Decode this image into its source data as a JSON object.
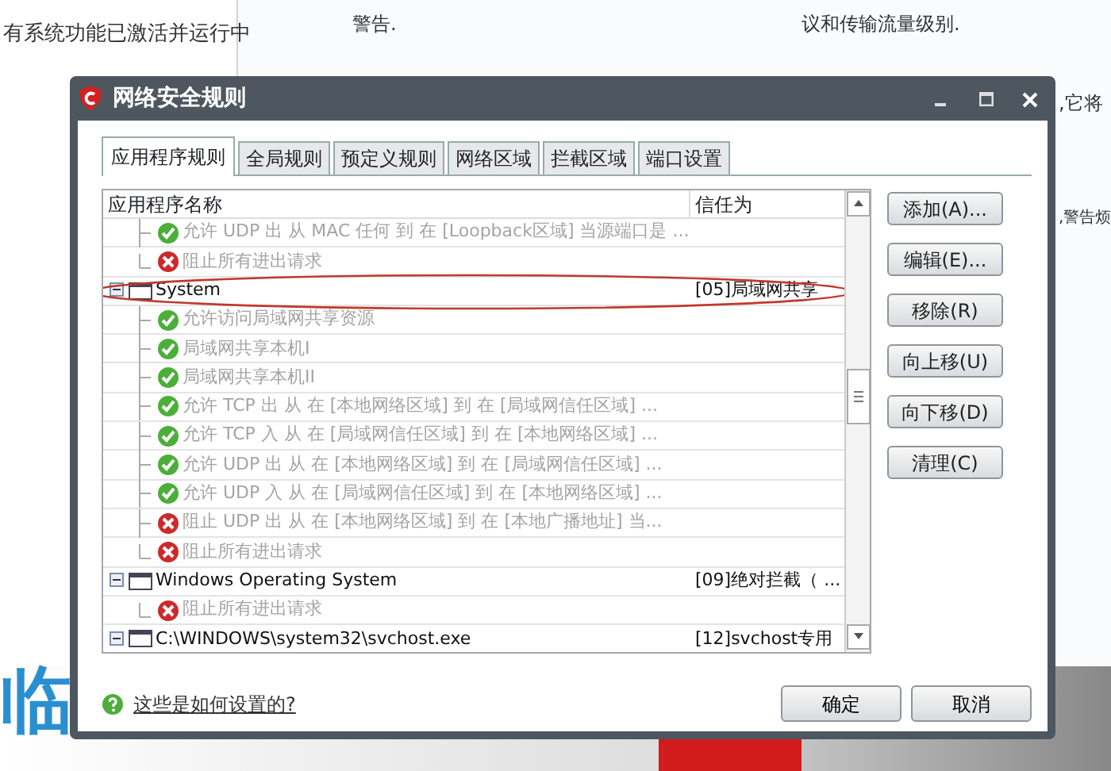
{
  "background": {
    "texts": [
      {
        "kind": "left",
        "text": "有系统功能已激活并运行中"
      },
      {
        "kind": "mid",
        "text": "警告."
      },
      {
        "kind": "right",
        "text": "议和传输流量级别."
      },
      {
        "kind": "edge1",
        "text": ",它将"
      },
      {
        "kind": "edge2",
        "text": ",警告烦"
      },
      {
        "kind": "big",
        "text": "临"
      }
    ]
  },
  "dialog": {
    "title": "网络安全规则",
    "tabs": [
      {
        "label": "应用程序规则",
        "selected": true
      },
      {
        "label": "全局规则",
        "selected": false
      },
      {
        "label": "预定义规则",
        "selected": false
      },
      {
        "label": "网络区域",
        "selected": false
      },
      {
        "label": "拦截区域",
        "selected": false
      },
      {
        "label": "端口设置",
        "selected": false
      }
    ],
    "table": {
      "columns": [
        "应用程序名称",
        "信任为"
      ],
      "rows": [
        {
          "kind": "rule",
          "blocked": false,
          "last": false,
          "name": "允许 UDP 出 从 MAC 任何 到 在 [Loopback区域] 当源端口是 ..."
        },
        {
          "kind": "rule",
          "blocked": true,
          "last": true,
          "name": "阻止所有进出请求"
        },
        {
          "kind": "group",
          "expanded": true,
          "highlighted": true,
          "name": "System",
          "trust": "[05]局域网共享"
        },
        {
          "kind": "rule",
          "blocked": false,
          "last": false,
          "name": "允许访问局域网共享资源"
        },
        {
          "kind": "rule",
          "blocked": false,
          "last": false,
          "name": "局域网共享本机I"
        },
        {
          "kind": "rule",
          "blocked": false,
          "last": false,
          "name": "局域网共享本机II"
        },
        {
          "kind": "rule",
          "blocked": false,
          "last": false,
          "name": "允许 TCP 出 从 在 [本地网络区域] 到 在 [局域网信任区域] ..."
        },
        {
          "kind": "rule",
          "blocked": false,
          "last": false,
          "name": "允许 TCP 入 从 在 [局域网信任区域] 到 在 [本地网络区域] ..."
        },
        {
          "kind": "rule",
          "blocked": false,
          "last": false,
          "name": "允许 UDP 出 从 在 [本地网络区域] 到 在 [局域网信任区域] ..."
        },
        {
          "kind": "rule",
          "blocked": false,
          "last": false,
          "name": "允许 UDP 入 从 在 [局域网信任区域] 到 在 [本地网络区域] ..."
        },
        {
          "kind": "rule",
          "blocked": true,
          "last": false,
          "name": "阻止 UDP 出 从 在 [本地网络区域] 到 在 [本地广播地址] 当..."
        },
        {
          "kind": "rule",
          "blocked": true,
          "last": true,
          "name": "阻止所有进出请求"
        },
        {
          "kind": "group",
          "expanded": true,
          "highlighted": false,
          "name": "Windows Operating System",
          "trust": "[09]绝对拦截（ ..."
        },
        {
          "kind": "rule",
          "blocked": true,
          "last": true,
          "name": "阻止所有进出请求"
        },
        {
          "kind": "group",
          "expanded": true,
          "highlighted": false,
          "name": "C:\\WINDOWS\\system32\\svchost.exe",
          "trust": "[12]svchost专用"
        }
      ]
    },
    "side_buttons": [
      "添加(A)...",
      "编辑(E)...",
      "移除(R)",
      "向上移(U)",
      "向下移(D)",
      "清理(C)"
    ],
    "help_link": "这些是如何设置的?",
    "buttons": [
      "确定",
      "取消"
    ]
  }
}
